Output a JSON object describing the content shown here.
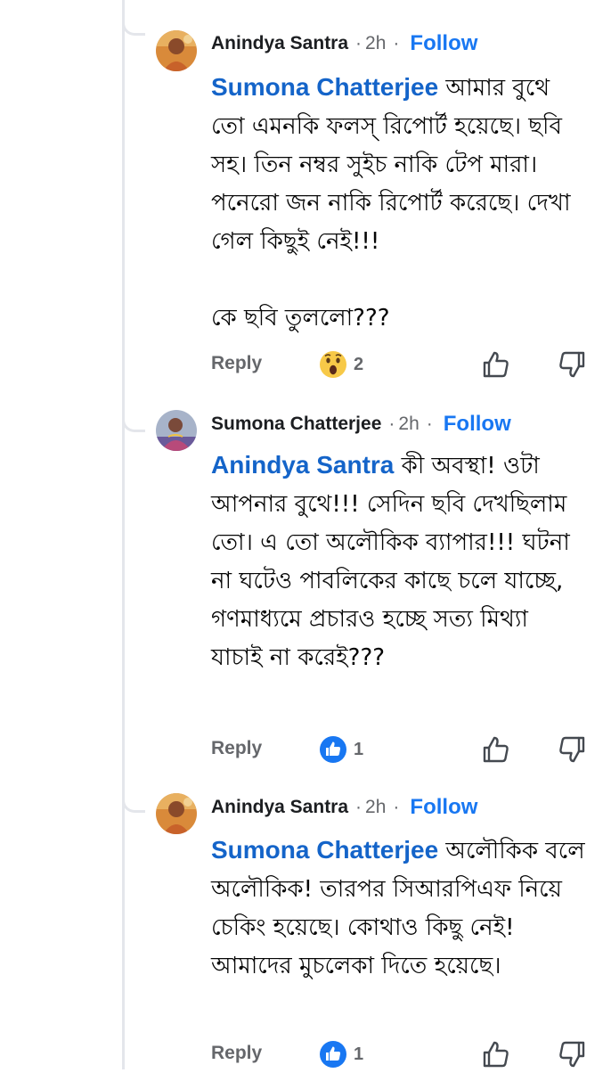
{
  "ui": {
    "reply_label": "Reply",
    "follow_label": "Follow",
    "separator": "·",
    "accent_color": "#1877f2",
    "mention_color": "#1464c9"
  },
  "comments": [
    {
      "author": "Anindya Santra",
      "time": "2h",
      "mention": "Sumona Chatterjee",
      "text": " আমার বুথে তো এমনকি ফলস্ রিপোর্ট হয়েছে। ছবি সহ। তিন নম্বর সুইচ নাকি টেপ মারা। পনেরো জন নাকি রিপোর্ট করেছে। দেখা গেল কিছুই নেই!!!\n\nকে ছবি তুললো???",
      "reaction_icon": "wow-reaction-icon",
      "reaction_count": "2"
    },
    {
      "author": "Sumona Chatterjee",
      "time": "2h",
      "mention": "Anindya Santra",
      "text": " কী অবস্থা! ওটা আপনার বুথে!!! সেদিন ছবি দেখছিলাম তো। এ তো অলৌকিক ব্যাপার!!! ঘটনা না ঘটেও পাবলিকের কাছে চলে যাচ্ছে, গণমাধ্যমে প্রচারও হচ্ছে সত্য মিথ্যা যাচাই না করেই???",
      "reaction_icon": "like-reaction-icon",
      "reaction_count": "1"
    },
    {
      "author": "Anindya Santra",
      "time": "2h",
      "mention": "Sumona Chatterjee",
      "text": " অলৌকিক বলে অলৌকিক! তারপর সিআরপিএফ নিয়ে চেকিং হয়েছে। কোথাও কিছু নেই! আমাদের মুচলেকা দিতে হয়েছে।",
      "reaction_icon": "like-reaction-icon",
      "reaction_count": "1"
    }
  ]
}
